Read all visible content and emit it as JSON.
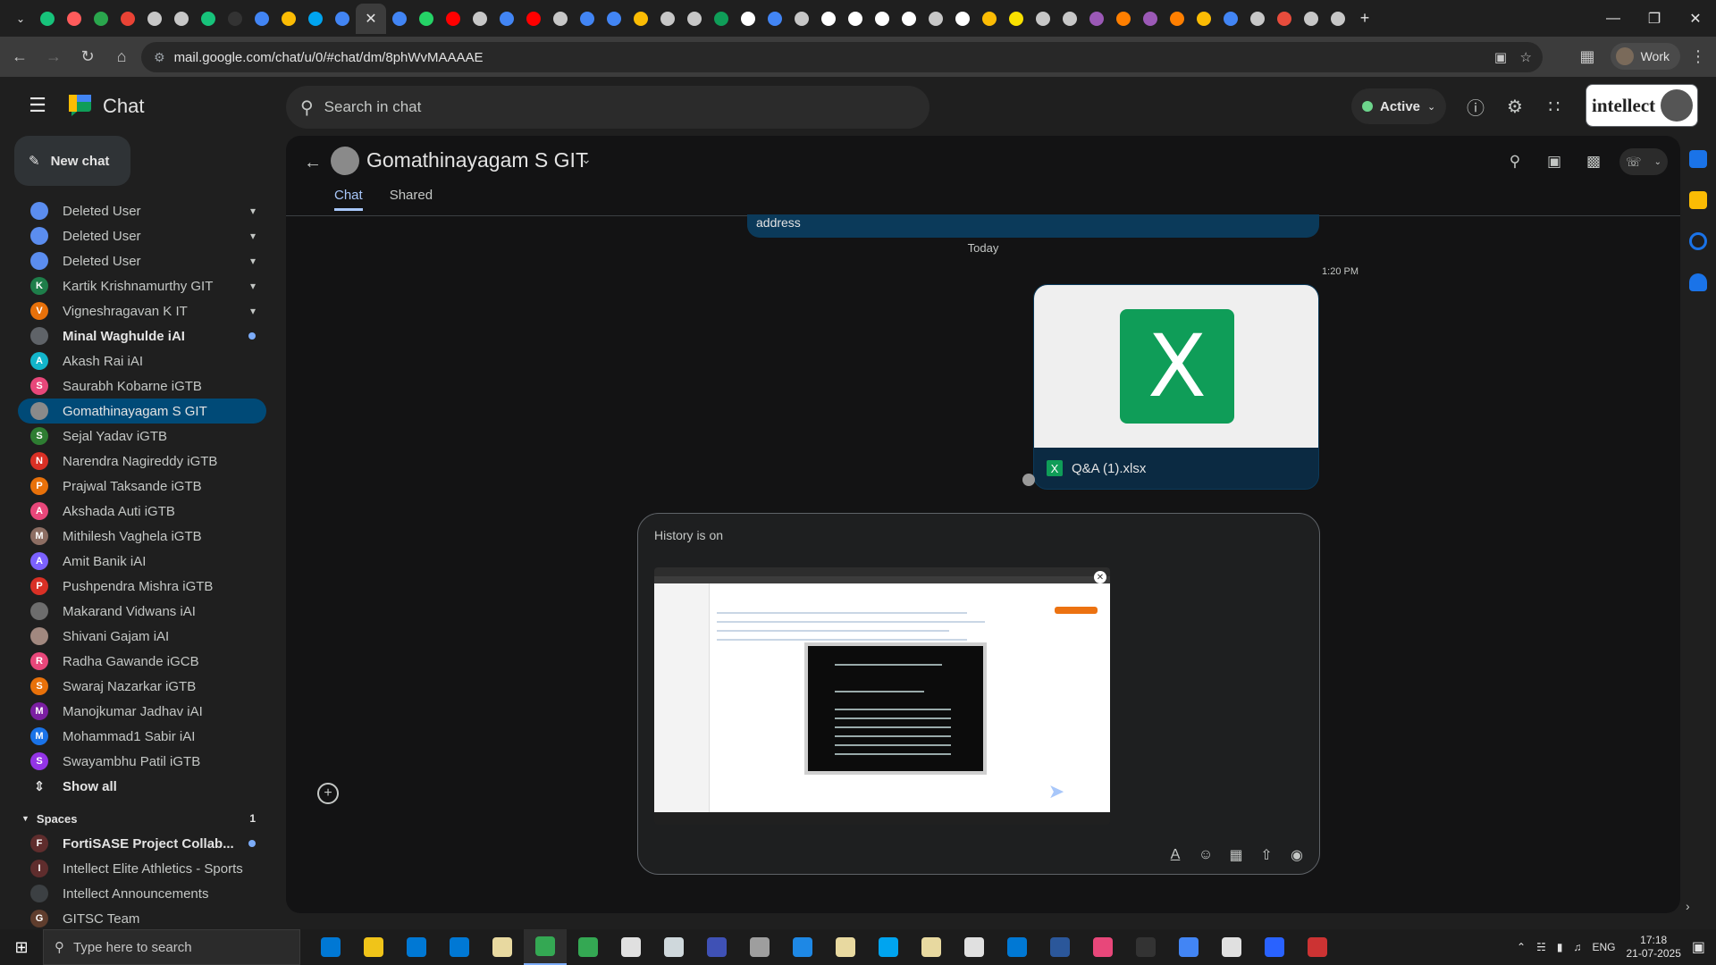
{
  "browser": {
    "url": "mail.google.com/chat/u/0/#chat/dm/8phWvMAAAAE",
    "profile_label": "Work",
    "new_tab_glyph": "+",
    "tab_favicon_colors": [
      "#17c37b",
      "#ff5b5b",
      "#2aa64d",
      "#ea4335",
      "#c7c7c7",
      "#c7c7c7",
      "#17c37b",
      "#333333",
      "#4285f4",
      "#fbbc04",
      "#00a4ef",
      "#4285f4",
      "#3c3c3c",
      "#4285f4",
      "#25d366",
      "#ff0000",
      "#c7c7c7",
      "#4285f4",
      "#ff0000",
      "#c7c7c7",
      "#4285f4",
      "#4285f4",
      "#fbbc04",
      "#c7c7c7",
      "#c7c7c7",
      "#0f9d58",
      "#ffffff",
      "#4285f4",
      "#c7c7c7",
      "#ffffff",
      "#ffffff",
      "#ffffff",
      "#ffffff",
      "#c7c7c7",
      "#ffffff",
      "#fbbc04",
      "#f9e100",
      "#c7c7c7",
      "#c7c7c7",
      "#9b59b6",
      "#ff7f00",
      "#9b59b6",
      "#ff7f00",
      "#fbbc04",
      "#4285f4",
      "#c7c7c7",
      "#e74c3c",
      "#c7c7c7",
      "#c7c7c7"
    ]
  },
  "app": {
    "name": "Chat",
    "search_placeholder": "Search in chat",
    "status": "Active",
    "brand": "intellect",
    "new_chat": "New chat"
  },
  "sidebar": {
    "dms": [
      {
        "name": "Deleted User",
        "initial": "",
        "color": "#5b8def",
        "pinned": true,
        "bold": false,
        "unread": false
      },
      {
        "name": "Deleted User",
        "initial": "",
        "color": "#5b8def",
        "pinned": true,
        "bold": false,
        "unread": false
      },
      {
        "name": "Deleted User",
        "initial": "",
        "color": "#5b8def",
        "pinned": true,
        "bold": false,
        "unread": false
      },
      {
        "name": "Kartik Krishnamurthy GIT",
        "initial": "K",
        "color": "#1e7e4a",
        "pinned": true,
        "bold": false,
        "unread": false
      },
      {
        "name": "Vigneshragavan K IT",
        "initial": "V",
        "color": "#e8710a",
        "pinned": true,
        "bold": false,
        "unread": false
      },
      {
        "name": "Minal Waghulde iAI",
        "initial": "",
        "color": "#5f6368",
        "pinned": false,
        "bold": true,
        "unread": true
      },
      {
        "name": "Akash Rai iAI",
        "initial": "A",
        "color": "#12b5cb",
        "pinned": false,
        "bold": false,
        "unread": false
      },
      {
        "name": "Saurabh Kobarne iGTB",
        "initial": "S",
        "color": "#e8477a",
        "pinned": false,
        "bold": false,
        "unread": false
      },
      {
        "name": "Gomathinayagam S GIT",
        "initial": "",
        "color": "#8a8a8a",
        "pinned": false,
        "bold": false,
        "unread": false,
        "selected": true
      },
      {
        "name": "Sejal Yadav iGTB",
        "initial": "S",
        "color": "#2e7d32",
        "pinned": false,
        "bold": false,
        "unread": false
      },
      {
        "name": "Narendra Nagireddy iGTB",
        "initial": "N",
        "color": "#d93025",
        "pinned": false,
        "bold": false,
        "unread": false
      },
      {
        "name": "Prajwal Taksande iGTB",
        "initial": "P",
        "color": "#e8710a",
        "pinned": false,
        "bold": false,
        "unread": false
      },
      {
        "name": "Akshada Auti iGTB",
        "initial": "A",
        "color": "#e8477a",
        "pinned": false,
        "bold": false,
        "unread": false
      },
      {
        "name": "Mithilesh Vaghela iGTB",
        "initial": "M",
        "color": "#8d6e63",
        "pinned": false,
        "bold": false,
        "unread": false
      },
      {
        "name": "Amit Banik iAI",
        "initial": "A",
        "color": "#7b61ff",
        "pinned": false,
        "bold": false,
        "unread": false
      },
      {
        "name": "Pushpendra Mishra iGTB",
        "initial": "P",
        "color": "#d93025",
        "pinned": false,
        "bold": false,
        "unread": false
      },
      {
        "name": "Makarand Vidwans iAI",
        "initial": "",
        "color": "#6d6d6d",
        "pinned": false,
        "bold": false,
        "unread": false
      },
      {
        "name": "Shivani Gajam iAI",
        "initial": "",
        "color": "#a1887f",
        "pinned": false,
        "bold": false,
        "unread": false
      },
      {
        "name": "Radha Gawande iGCB",
        "initial": "R",
        "color": "#e8477a",
        "pinned": false,
        "bold": false,
        "unread": false
      },
      {
        "name": "Swaraj Nazarkar iGTB",
        "initial": "S",
        "color": "#e8710a",
        "pinned": false,
        "bold": false,
        "unread": false
      },
      {
        "name": "Manojkumar Jadhav iAI",
        "initial": "M",
        "color": "#7b1fa2",
        "pinned": false,
        "bold": false,
        "unread": false
      },
      {
        "name": "Mohammad1 Sabir iAI",
        "initial": "M",
        "color": "#1a73e8",
        "pinned": false,
        "bold": false,
        "unread": false
      },
      {
        "name": "Swayambhu Patil iGTB",
        "initial": "S",
        "color": "#9334e6",
        "pinned": false,
        "bold": false,
        "unread": false
      }
    ],
    "show_all": "Show all",
    "spaces_label": "Spaces",
    "spaces_count": "1",
    "spaces": [
      {
        "name": "FortiSASE Project Collab...",
        "initial": "F",
        "color": "#5f2d2d",
        "bold": true,
        "unread": true
      },
      {
        "name": "Intellect Elite Athletics - Sports",
        "initial": "I",
        "color": "#5f2d2d",
        "bold": false,
        "unread": false
      },
      {
        "name": "Intellect Announcements",
        "initial": "",
        "color": "#3c4043",
        "bold": false,
        "unread": false
      },
      {
        "name": "GITSC Team",
        "initial": "G",
        "color": "#5f3d2d",
        "bold": false,
        "unread": false
      }
    ]
  },
  "conversation": {
    "title": "Gomathinayagam S GIT",
    "tabs": [
      "Chat",
      "Shared"
    ],
    "prev_message_tail": "address",
    "date_separator": "Today",
    "timestamp": "1:20 PM",
    "attachment_name": "Q&A (1).xlsx",
    "excel_glyph": "X",
    "composer_placeholder": "History is on"
  },
  "taskbar": {
    "search_placeholder": "Type here to search",
    "time": "17:18",
    "date": "21-07-2025",
    "lang": "ENG",
    "app_colors": [
      "#0078d4",
      "#f0c419",
      "#0078d4",
      "#0078d4",
      "#e8d9a0",
      "#34a853",
      "#34a853",
      "#e0e0e0",
      "#cfd8dc",
      "#3f51b5",
      "#9e9e9e",
      "#1e88e5",
      "#e8d9a0",
      "#00a4ef",
      "#e8d9a0",
      "#e0e0e0",
      "#0078d4",
      "#2b579a",
      "#e8477a",
      "#333333",
      "#4285f4",
      "#e0e0e0",
      "#2962ff",
      "#cc3333"
    ]
  },
  "colors": {
    "accent": "#a8c7fa",
    "selected_bg": "#004a77",
    "status_active": "#6dd58c",
    "excel_green": "#0f9d58"
  }
}
